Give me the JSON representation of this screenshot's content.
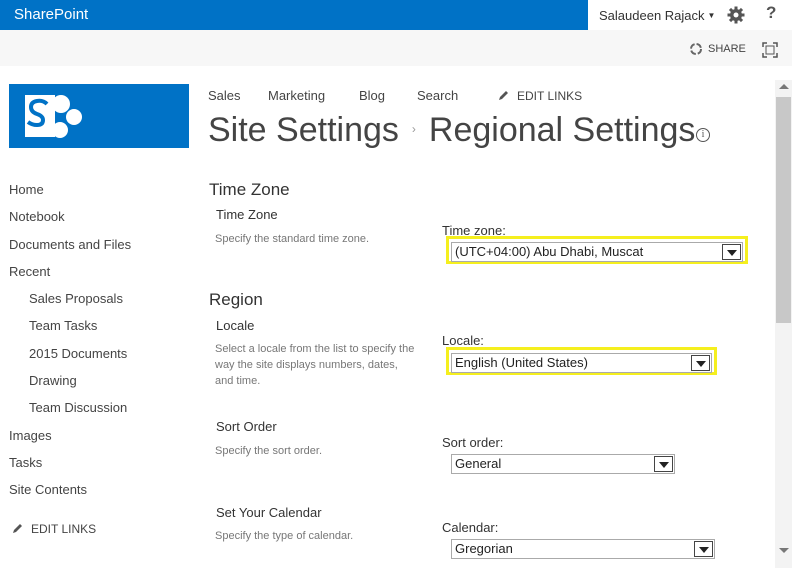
{
  "suite": {
    "brand": "SharePoint",
    "user": "Salaudeen Rajack",
    "help": "?"
  },
  "ribbon": {
    "share": "SHARE"
  },
  "topnav": {
    "items": [
      "Sales",
      "Marketing",
      "Blog",
      "Search"
    ],
    "edit_links": "EDIT LINKS"
  },
  "title": {
    "parent": "Site Settings",
    "separator": "›",
    "current": "Regional Settings"
  },
  "leftnav": {
    "items": [
      "Home",
      "Notebook",
      "Documents and Files",
      "Recent",
      "Images",
      "Tasks",
      "Site Contents"
    ],
    "recent": [
      "Sales Proposals",
      "Team Tasks",
      "2015 Documents",
      "Drawing",
      "Team Discussion"
    ],
    "edit_links": "EDIT LINKS"
  },
  "timezone": {
    "heading": "Time Zone",
    "label": "Time Zone",
    "description": "Specify the standard time zone.",
    "field_label": "Time zone:",
    "value": "(UTC+04:00) Abu Dhabi, Muscat"
  },
  "region": {
    "heading": "Region"
  },
  "locale": {
    "label": "Locale",
    "description": "Select a locale from the list to specify the way the site displays numbers, dates, and time.",
    "field_label": "Locale:",
    "value": "English (United States)"
  },
  "sortorder": {
    "label": "Sort Order",
    "description": "Specify the sort order.",
    "field_label": "Sort order:",
    "value": "General"
  },
  "calendar": {
    "label": "Set Your Calendar",
    "description": "Specify the type of calendar.",
    "field_label": "Calendar:",
    "value": "Gregorian"
  },
  "colors": {
    "brand": "#0072c6",
    "highlight": "#f5ef1e"
  }
}
